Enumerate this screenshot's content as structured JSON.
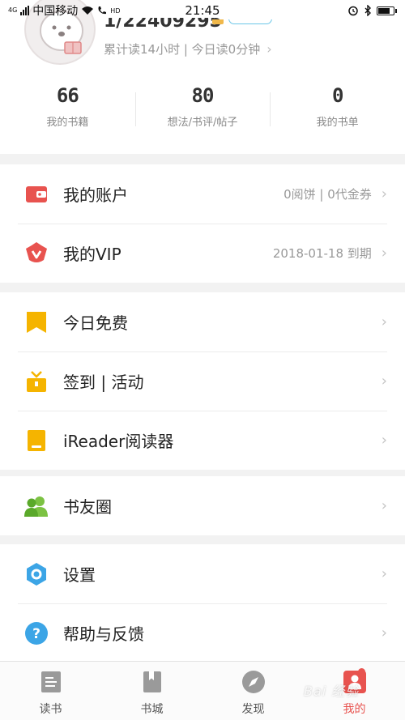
{
  "status_bar": {
    "network": "4G",
    "carrier": "中国移动",
    "hd": "HD",
    "time": "21:45"
  },
  "profile": {
    "username": "1/22409295",
    "reading_stats": "累计读14小时 | 今日读0分钟",
    "counts": [
      {
        "value": "66",
        "label": "我的书籍"
      },
      {
        "value": "80",
        "label": "想法/书评/帖子"
      },
      {
        "value": "0",
        "label": "我的书单"
      }
    ]
  },
  "menu": {
    "account": {
      "label": "我的账户",
      "value": "0阅饼 | 0代金券",
      "icon": "wallet-icon",
      "color": "#e8534f"
    },
    "vip": {
      "label": "我的VIP",
      "value": "2018-01-18 到期",
      "icon": "vip-crown-icon",
      "color": "#e8534f"
    },
    "free_today": {
      "label": "今日免费",
      "icon": "bookmark-icon",
      "color": "#f5b400"
    },
    "checkin": {
      "label": "签到 | 活动",
      "icon": "gift-icon",
      "color": "#f5b400"
    },
    "ireader": {
      "label": "iReader阅读器",
      "icon": "ereader-icon",
      "color": "#f5b400"
    },
    "book_friends": {
      "label": "书友圈",
      "icon": "friends-icon",
      "color": "#7cc243"
    },
    "settings": {
      "label": "设置",
      "icon": "hexagon-settings-icon",
      "color": "#3ca5e6"
    },
    "help": {
      "label": "帮助与反馈",
      "icon": "help-icon",
      "color": "#3ca5e6"
    }
  },
  "tabs": [
    {
      "label": "读书",
      "icon": "book-icon"
    },
    {
      "label": "书城",
      "icon": "bookstore-icon"
    },
    {
      "label": "发现",
      "icon": "compass-icon"
    },
    {
      "label": "我的",
      "icon": "profile-icon",
      "active": true
    }
  ],
  "watermark": "Bai 经验"
}
